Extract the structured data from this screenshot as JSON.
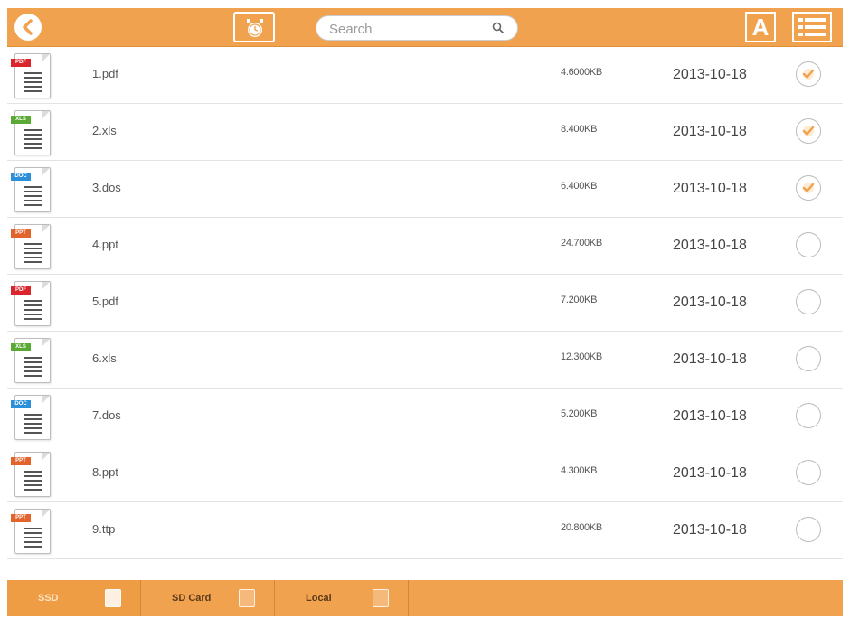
{
  "toolbar": {
    "search_placeholder": "Search",
    "font_button_label": "A",
    "icons": {
      "back": "back-arrow-icon",
      "history": "alarm-clock-icon",
      "search": "search-icon",
      "view": "list-view-icon"
    }
  },
  "files": [
    {
      "name": "1.pdf",
      "size": "4.6000KB",
      "date": "2013-10-18",
      "type": "PDF",
      "tag_color": "#d9252b",
      "checked": true
    },
    {
      "name": "2.xls",
      "size": "8.400KB",
      "date": "2013-10-18",
      "type": "XLS",
      "tag_color": "#5aa935",
      "checked": true
    },
    {
      "name": "3.dos",
      "size": "6.400KB",
      "date": "2013-10-18",
      "type": "DOC",
      "tag_color": "#2b8fd9",
      "checked": true
    },
    {
      "name": "4.ppt",
      "size": "24.700KB",
      "date": "2013-10-18",
      "type": "PPT",
      "tag_color": "#e2632b",
      "checked": false
    },
    {
      "name": "5.pdf",
      "size": "7.200KB",
      "date": "2013-10-18",
      "type": "PDF",
      "tag_color": "#d9252b",
      "checked": false
    },
    {
      "name": "6.xls",
      "size": "12.300KB",
      "date": "2013-10-18",
      "type": "XLS",
      "tag_color": "#5aa935",
      "checked": false
    },
    {
      "name": "7.dos",
      "size": "5.200KB",
      "date": "2013-10-18",
      "type": "DOC",
      "tag_color": "#2b8fd9",
      "checked": false
    },
    {
      "name": "8.ppt",
      "size": "4.300KB",
      "date": "2013-10-18",
      "type": "PPT",
      "tag_color": "#e2632b",
      "checked": false
    },
    {
      "name": "9.ttp",
      "size": "20.800KB",
      "date": "2013-10-18",
      "type": "PPT",
      "tag_color": "#e2632b",
      "checked": false
    }
  ],
  "bottom_tabs": [
    {
      "label": "SSD",
      "icon": "ssd-drive-icon",
      "active": true
    },
    {
      "label": "SD Card",
      "icon": "sd-card-icon",
      "active": false
    },
    {
      "label": "Local",
      "icon": "local-storage-icon",
      "active": false
    }
  ],
  "colors": {
    "accent": "#f0a24f",
    "check": "#f0a24f"
  }
}
